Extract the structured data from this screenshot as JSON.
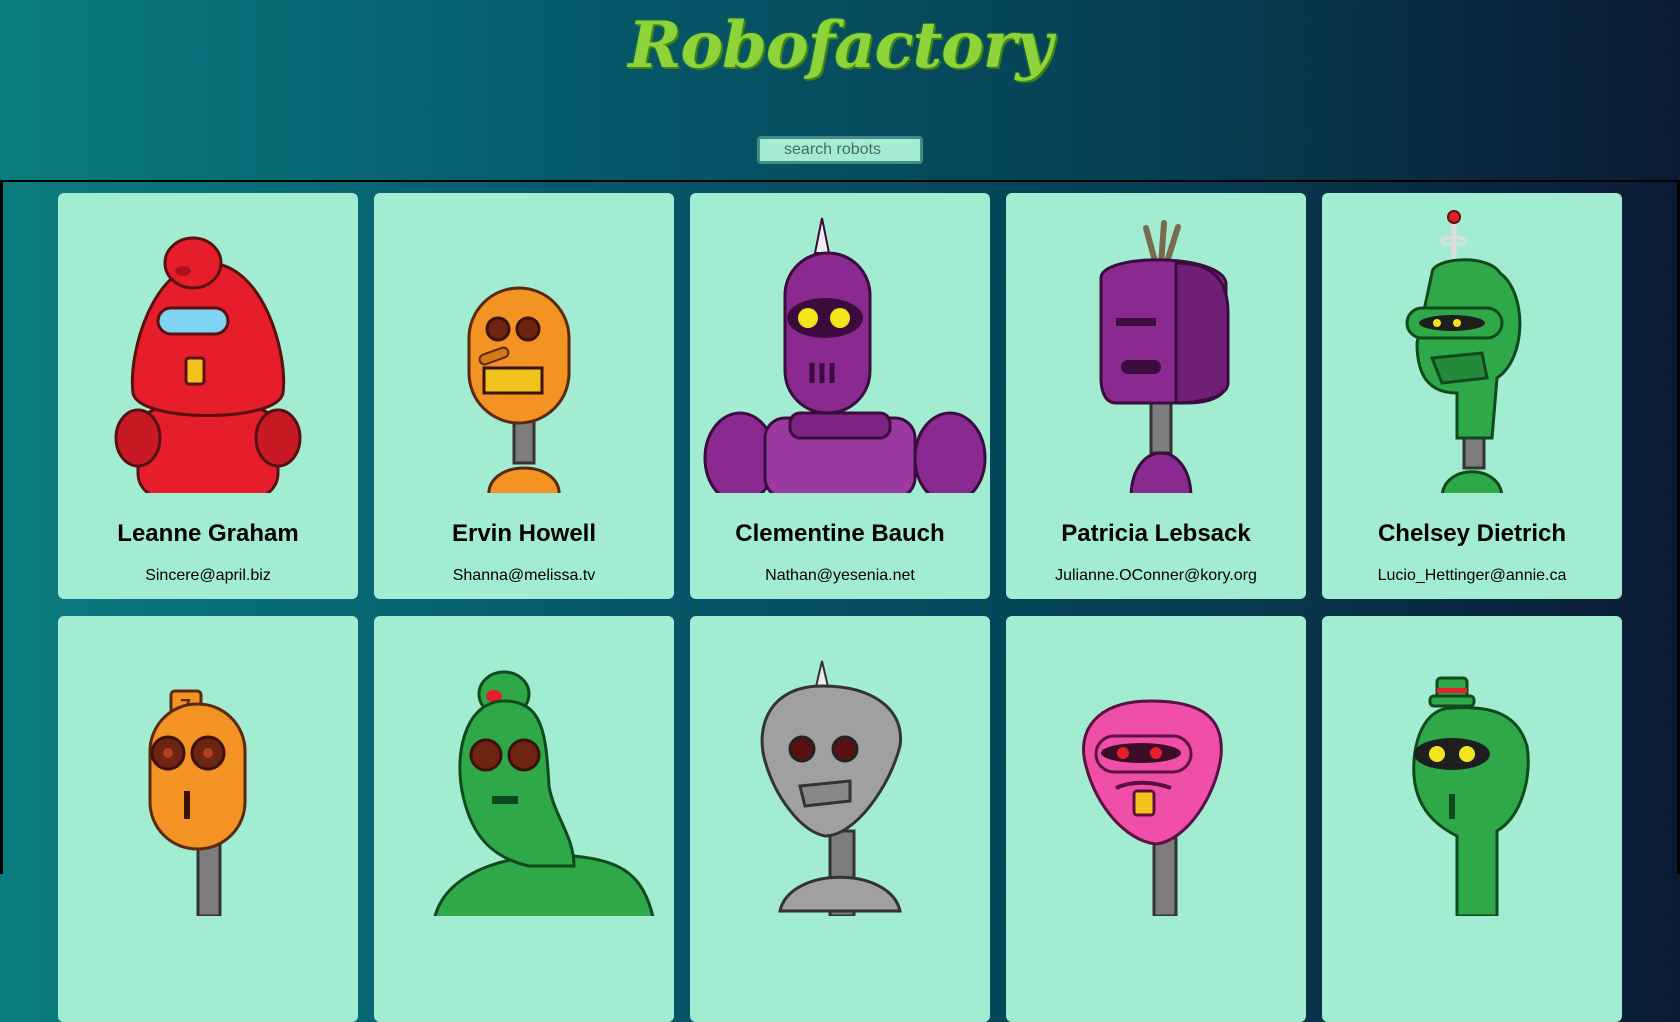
{
  "header": {
    "title": "Robofactory"
  },
  "search": {
    "placeholder": "search robots"
  },
  "robots": [
    {
      "name": "Leanne Graham",
      "email": "Sincere@april.biz",
      "color": "#e61e2b"
    },
    {
      "name": "Ervin Howell",
      "email": "Shanna@melissa.tv",
      "color": "#f39323"
    },
    {
      "name": "Clementine Bauch",
      "email": "Nathan@yesenia.net",
      "color": "#8a2a90"
    },
    {
      "name": "Patricia Lebsack",
      "email": "Julianne.OConner@kory.org",
      "color": "#8a2a90"
    },
    {
      "name": "Chelsey Dietrich",
      "email": "Lucio_Hettinger@annie.ca",
      "color": "#2fa84a"
    },
    {
      "name": "",
      "email": "",
      "color": "#f39323"
    },
    {
      "name": "",
      "email": "",
      "color": "#2fa84a"
    },
    {
      "name": "",
      "email": "",
      "color": "#a0a0a0"
    },
    {
      "name": "",
      "email": "",
      "color": "#f04fa8"
    },
    {
      "name": "",
      "email": "",
      "color": "#2fa84a"
    }
  ]
}
